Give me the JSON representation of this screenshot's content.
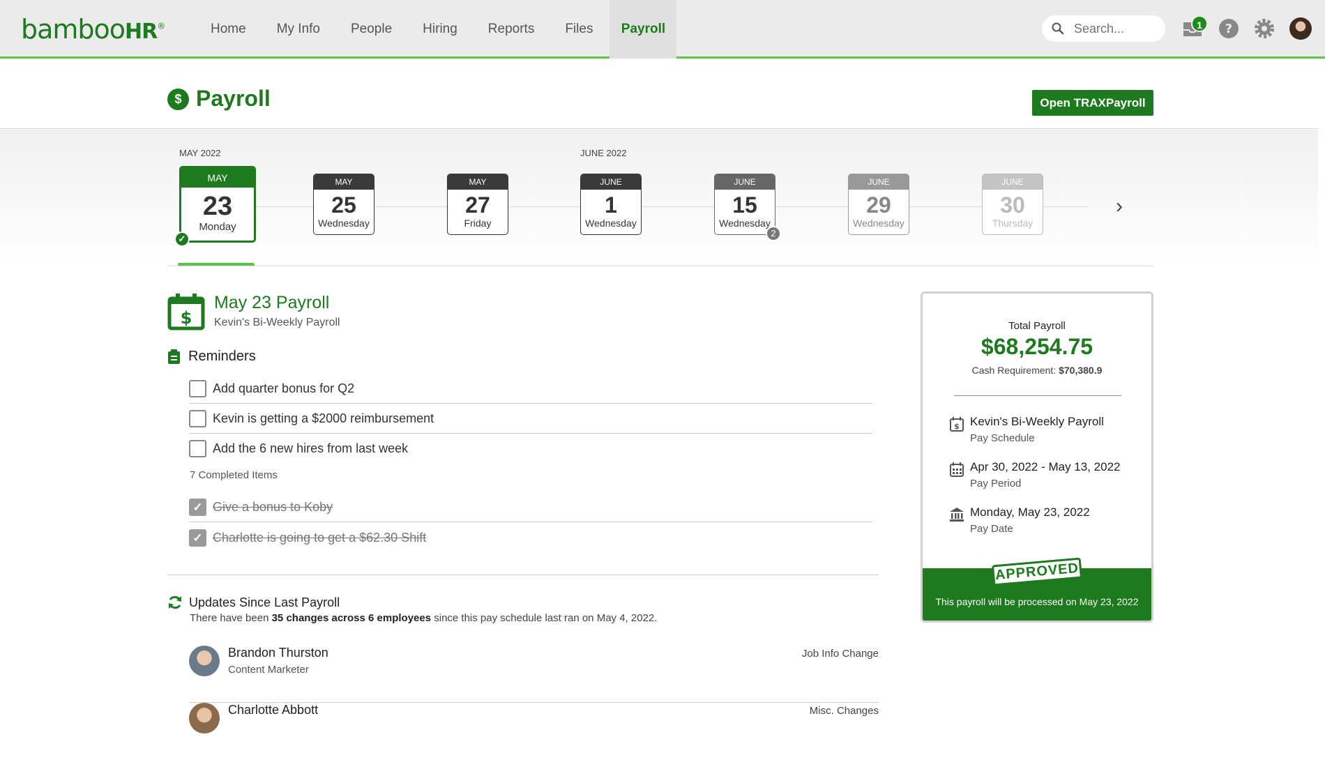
{
  "header": {
    "logo_main": "bamboo",
    "logo_hr": "HR",
    "logo_reg": "®",
    "nav": [
      "Home",
      "My Info",
      "People",
      "Hiring",
      "Reports",
      "Files",
      "Payroll"
    ],
    "active_nav": "Payroll",
    "search_placeholder": "Search...",
    "notification_count": "1",
    "icons": [
      "search-icon",
      "inbox-icon",
      "help-icon",
      "gear-icon",
      "avatar"
    ]
  },
  "page": {
    "title": "Payroll",
    "title_icon": "$",
    "open_button": "Open TRAXPayroll"
  },
  "timeline": {
    "month_labels": [
      "MAY 2022",
      "JUNE 2022"
    ],
    "dates": [
      {
        "month": "MAY",
        "day": "23",
        "weekday": "Monday"
      },
      {
        "month": "MAY",
        "day": "25",
        "weekday": "Wednesday"
      },
      {
        "month": "MAY",
        "day": "27",
        "weekday": "Friday"
      },
      {
        "month": "JUNE",
        "day": "1",
        "weekday": "Wednesday"
      },
      {
        "month": "JUNE",
        "day": "15",
        "weekday": "Wednesday"
      },
      {
        "month": "JUNE",
        "day": "29",
        "weekday": "Wednesday"
      },
      {
        "month": "JUNE",
        "day": "30",
        "weekday": "Thursday"
      }
    ],
    "check_mark": "✓",
    "june15_count": "2",
    "next_arrow": "›"
  },
  "payroll": {
    "title": "May 23 Payroll",
    "subtitle": "Kevin's Bi-Weekly Payroll",
    "reminders_title": "Reminders",
    "reminders": [
      "Add quarter bonus for Q2",
      "Kevin is getting a $2000 reimbursement",
      "Add the 6 new hires from last week"
    ],
    "completed_label": "7 Completed Items",
    "completed": [
      "Give a bonus to Koby",
      "Charlotte is going to get a $62.30 Shift"
    ],
    "check_mark": "✓"
  },
  "updates": {
    "title": "Updates Since Last Payroll",
    "sub_pre": "There have been ",
    "sub_bold": "35 changes across 6 employees",
    "sub_post": " since this pay schedule last ran on May 4, 2022.",
    "employees": [
      {
        "name": "Brandon Thurston",
        "role": "Content Marketer",
        "change": "Job Info Change"
      },
      {
        "name": "Charlotte Abbott",
        "role": "",
        "change": "Misc. Changes"
      }
    ]
  },
  "summary": {
    "total_label": "Total Payroll",
    "total_value": "$68,254.75",
    "cash_label": "Cash Requirement:",
    "cash_value": "$70,380.9",
    "schedule_main": "Kevin's Bi-Weekly Payroll",
    "schedule_sub": "Pay Schedule",
    "period_main": "Apr 30, 2022 - May 13, 2022",
    "period_sub": "Pay Period",
    "date_main": "Monday, May 23, 2022",
    "date_sub": "Pay Date",
    "stamp": "APPROVED",
    "footer": "This payroll will be processed on May 23, 2022"
  },
  "colors": {
    "brand_green": "#1e7a1e",
    "accent_green": "#5cc24a"
  }
}
